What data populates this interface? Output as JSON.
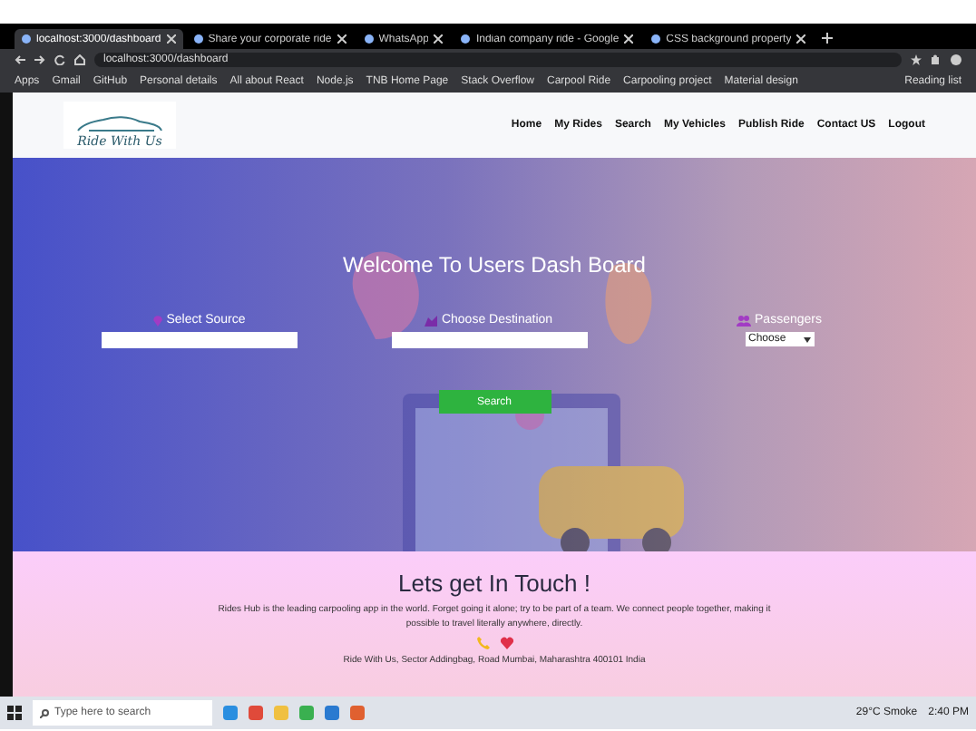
{
  "browser": {
    "tabs": [
      {
        "title": "localhost:3000/dashboard",
        "selected": true
      },
      {
        "title": "Share your corporate ride",
        "selected": false
      },
      {
        "title": "WhatsApp",
        "selected": false
      },
      {
        "title": "Indian company ride - Google",
        "selected": false
      },
      {
        "title": "CSS background property",
        "selected": false
      }
    ],
    "url": "localhost:3000/dashboard",
    "bookmarks": [
      "Apps",
      "Gmail",
      "GitHub",
      "Personal details",
      "All about React",
      "Node.js",
      "TNB Home Page",
      "Stack Overflow",
      "Carpool Ride",
      "Carpooling project",
      "Material design"
    ],
    "reading_list": "Reading list"
  },
  "site": {
    "logo": "Ride With Us",
    "nav": [
      "Home",
      "My Rides",
      "Search",
      "My Vehicles",
      "Publish Ride",
      "Contact US",
      "Logout"
    ]
  },
  "hero": {
    "title": "Welcome To Users Dash Board",
    "source_label": "Select Source",
    "destination_label": "Choose Destination",
    "passengers_label": "Passengers",
    "passengers_value": "Choose",
    "search_button": "Search"
  },
  "contact": {
    "title": "Lets get In Touch !",
    "text": "Rides Hub is the leading carpooling app in the world. Forget going it alone; try to be part of a team. We connect people together, making it possible to travel literally anywhere, directly.",
    "address": "Ride With Us, Sector Addingbag, Road Mumbai, Maharashtra 400101 India"
  },
  "taskbar": {
    "search_placeholder": "Type here to search",
    "weather": "29°C Smoke",
    "time": "2:40 PM"
  }
}
